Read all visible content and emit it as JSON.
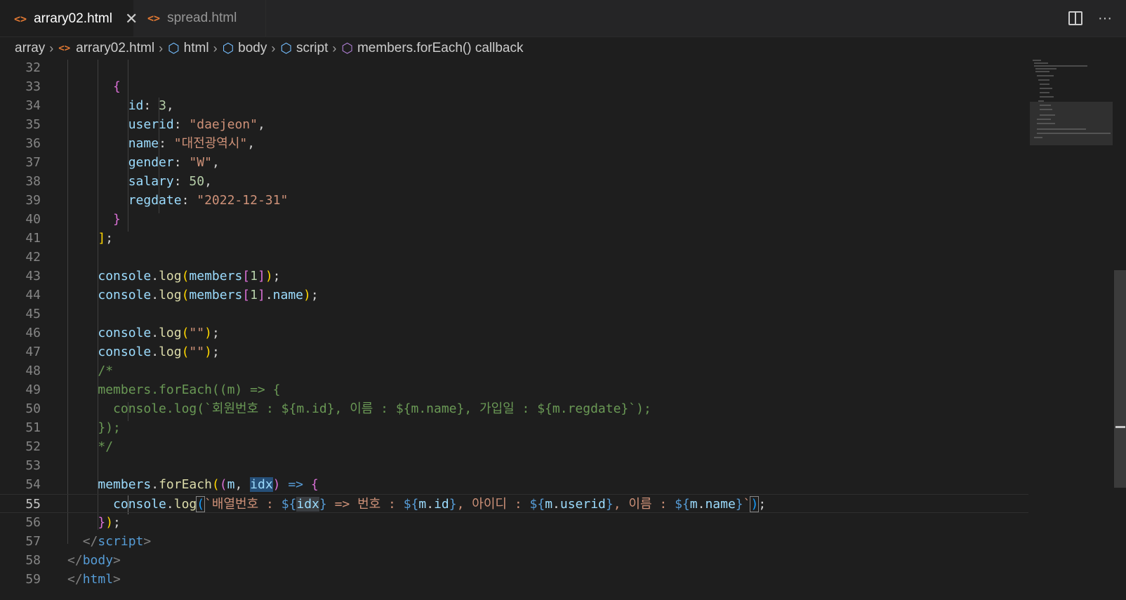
{
  "tabs": [
    {
      "label": "arrary02.html",
      "active": true,
      "icon": "code-icon"
    },
    {
      "label": "spread.html",
      "active": false,
      "icon": "code-icon"
    }
  ],
  "tab_close": "✕",
  "actions": {
    "more": "···"
  },
  "breadcrumb": {
    "folder": "array",
    "file": "arrary02.html",
    "html": "html",
    "body": "body",
    "script": "script",
    "symbol": "members.forEach() callback"
  },
  "lines": [
    {
      "n": "32"
    },
    {
      "n": "33"
    },
    {
      "n": "34"
    },
    {
      "n": "35"
    },
    {
      "n": "36"
    },
    {
      "n": "37"
    },
    {
      "n": "38"
    },
    {
      "n": "39"
    },
    {
      "n": "40"
    },
    {
      "n": "41"
    },
    {
      "n": "42"
    },
    {
      "n": "43"
    },
    {
      "n": "44"
    },
    {
      "n": "45"
    },
    {
      "n": "46"
    },
    {
      "n": "47"
    },
    {
      "n": "48"
    },
    {
      "n": "49"
    },
    {
      "n": "50"
    },
    {
      "n": "51"
    },
    {
      "n": "52"
    },
    {
      "n": "53"
    },
    {
      "n": "54"
    },
    {
      "n": "55"
    },
    {
      "n": "56"
    },
    {
      "n": "57"
    },
    {
      "n": "58"
    },
    {
      "n": "59"
    }
  ],
  "code": {
    "l34_key": "id",
    "l34_val": "3",
    "l35_key": "userid",
    "l35_val": "\"daejeon\"",
    "l36_key": "name",
    "l36_val": "\"대전광역시\"",
    "l37_key": "gender",
    "l37_val": "\"W\"",
    "l38_key": "salary",
    "l38_val": "50",
    "l39_key": "regdate",
    "l39_val": "\"2022-12-31\"",
    "console": "console",
    "log": "log",
    "members": "members",
    "name": "name",
    "one": "1",
    "empty_str": "\"\"",
    "c48": "/*",
    "c49": "members.forEach((m) => {",
    "c50": "console.log(`회원번호 : ${m.id}, 이름 : ${m.name}, 가입일 : ${m.regdate}`);",
    "c51": "});",
    "c52": "*/",
    "forEach": "forEach",
    "m": "m",
    "idx": "idx",
    "tpl_a": "`배열번호 : ",
    "tpl_b": " => 번호 : ",
    "tpl_c": ", 아이디 : ",
    "tpl_d": ", 이름 : ",
    "tpl_e": "`",
    "id": "id",
    "userid": "userid",
    "script": "script",
    "body": "body",
    "html": "html"
  }
}
